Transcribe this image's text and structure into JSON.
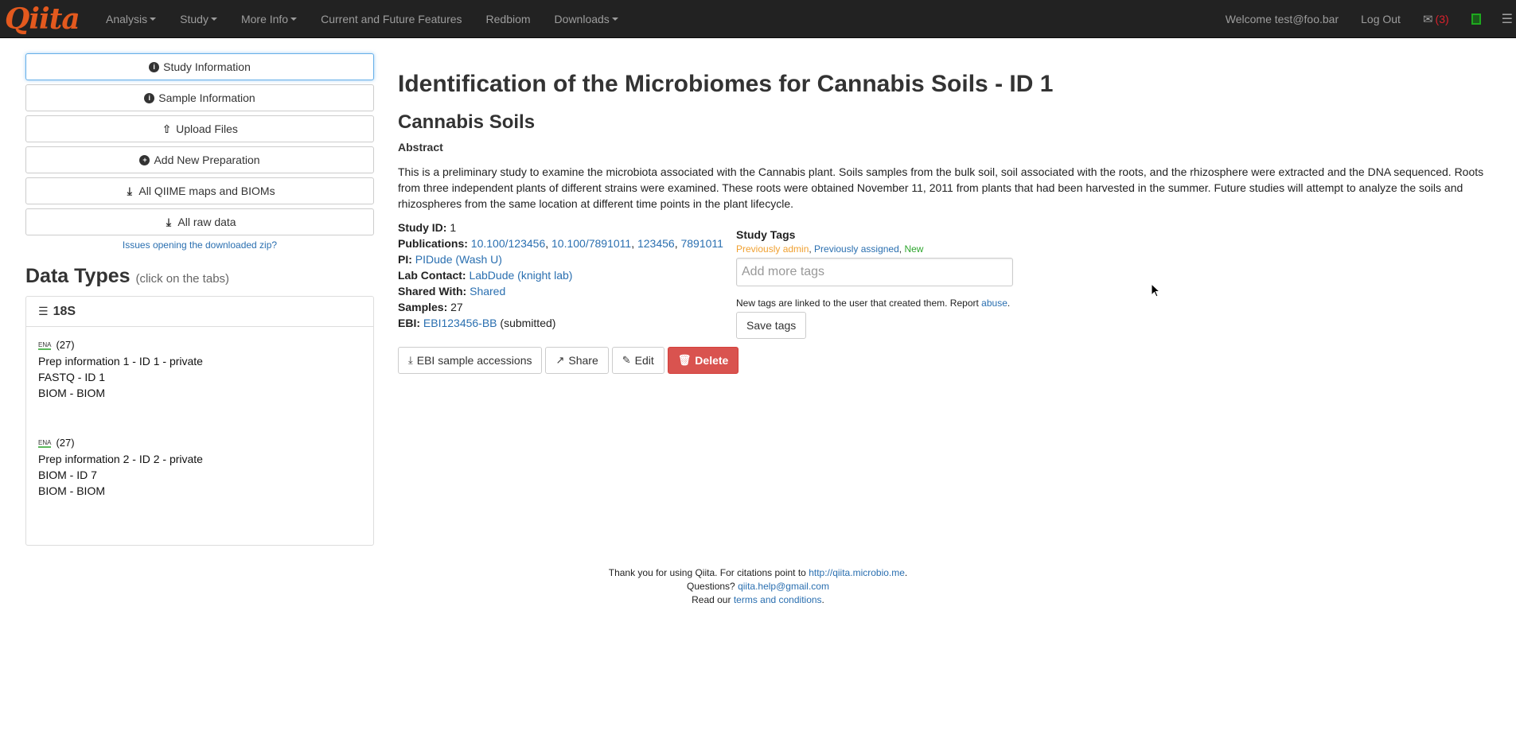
{
  "navbar": {
    "brand": "Qiita",
    "items": [
      {
        "label": "Analysis",
        "dropdown": true
      },
      {
        "label": "Study",
        "dropdown": true
      },
      {
        "label": "More Info",
        "dropdown": true
      },
      {
        "label": "Current and Future Features",
        "dropdown": false
      },
      {
        "label": "Redbiom",
        "dropdown": false
      },
      {
        "label": "Downloads",
        "dropdown": true
      }
    ],
    "welcome": "Welcome test@foo.bar",
    "logout": "Log Out",
    "mail_count": "(3)",
    "icons": [
      "mail-icon",
      "status-icon",
      "menu-list-icon"
    ]
  },
  "sidebar": {
    "buttons": [
      {
        "label": "Study Information",
        "icon": "info-circle-icon"
      },
      {
        "label": "Sample Information",
        "icon": "info-circle-icon"
      },
      {
        "label": "Upload Files",
        "icon": "upload-icon"
      },
      {
        "label": "Add New Preparation",
        "icon": "plus-circle-icon"
      },
      {
        "label": "All QIIME maps and BIOMs",
        "icon": "download-icon"
      },
      {
        "label": "All raw data",
        "icon": "download-icon"
      }
    ],
    "issues_link": "Issues opening the downloaded zip?"
  },
  "data_types": {
    "heading": "Data Types",
    "hint": "(click on the tabs)",
    "tab": "18S",
    "preps": [
      {
        "ena": "ENA",
        "count": "(27)",
        "lines": [
          "Prep information 1 - ID 1 - private",
          "FASTQ - ID 1",
          "BIOM - BIOM"
        ]
      },
      {
        "ena": "ENA",
        "count": "(27)",
        "lines": [
          "Prep information 2 - ID 2 - private",
          "BIOM - ID 7",
          "BIOM - BIOM"
        ]
      }
    ]
  },
  "main": {
    "title": "Identification of the Microbiomes for Cannabis Soils - ID 1",
    "subtitle": "Cannabis Soils",
    "abstract_label": "Abstract",
    "abstract": "This is a preliminary study to examine the microbiota associated with the Cannabis plant. Soils samples from the bulk soil, soil associated with the roots, and the rhizosphere were extracted and the DNA sequenced. Roots from three independent plants of different strains were examined. These roots were obtained November 11, 2011 from plants that had been harvested in the summer. Future studies will attempt to analyze the soils and rhizospheres from the same location at different time points in the plant lifecycle.",
    "info": {
      "study_id_label": "Study ID:",
      "study_id": "1",
      "publications_label": "Publications:",
      "publications": [
        "10.100/123456",
        "10.100/7891011",
        "123456",
        "7891011"
      ],
      "pi_label": "PI:",
      "pi": "PIDude (Wash U)",
      "lab_contact_label": "Lab Contact:",
      "lab_contact": "LabDude (knight lab)",
      "shared_with_label": "Shared With:",
      "shared_with": "Shared",
      "samples_label": "Samples:",
      "samples": "27",
      "ebi_label": "EBI:",
      "ebi": "EBI123456-BB",
      "ebi_status": "(submitted)"
    },
    "actions": [
      {
        "label": "EBI sample accessions",
        "icon": "download-icon"
      },
      {
        "label": "Share",
        "icon": "share-icon"
      },
      {
        "label": "Edit",
        "icon": "edit-icon"
      },
      {
        "label": "Delete",
        "icon": "trash-icon"
      }
    ],
    "tags": {
      "title": "Study Tags",
      "legend_admin": "Previously admin",
      "legend_assigned": "Previously assigned",
      "legend_new": "New",
      "placeholder": "Add more tags",
      "note_prefix": "New tags are linked to the user that created them. Report ",
      "note_link": "abuse",
      "save": "Save tags"
    }
  },
  "footer": {
    "line1_prefix": "Thank you for using Qiita. For citations point to ",
    "line1_link": "http://qiita.microbio.me",
    "line2_prefix": "Questions? ",
    "line2_link": "qiita.help@gmail.com",
    "line3_prefix": "Read our ",
    "line3_link": "terms and conditions"
  }
}
